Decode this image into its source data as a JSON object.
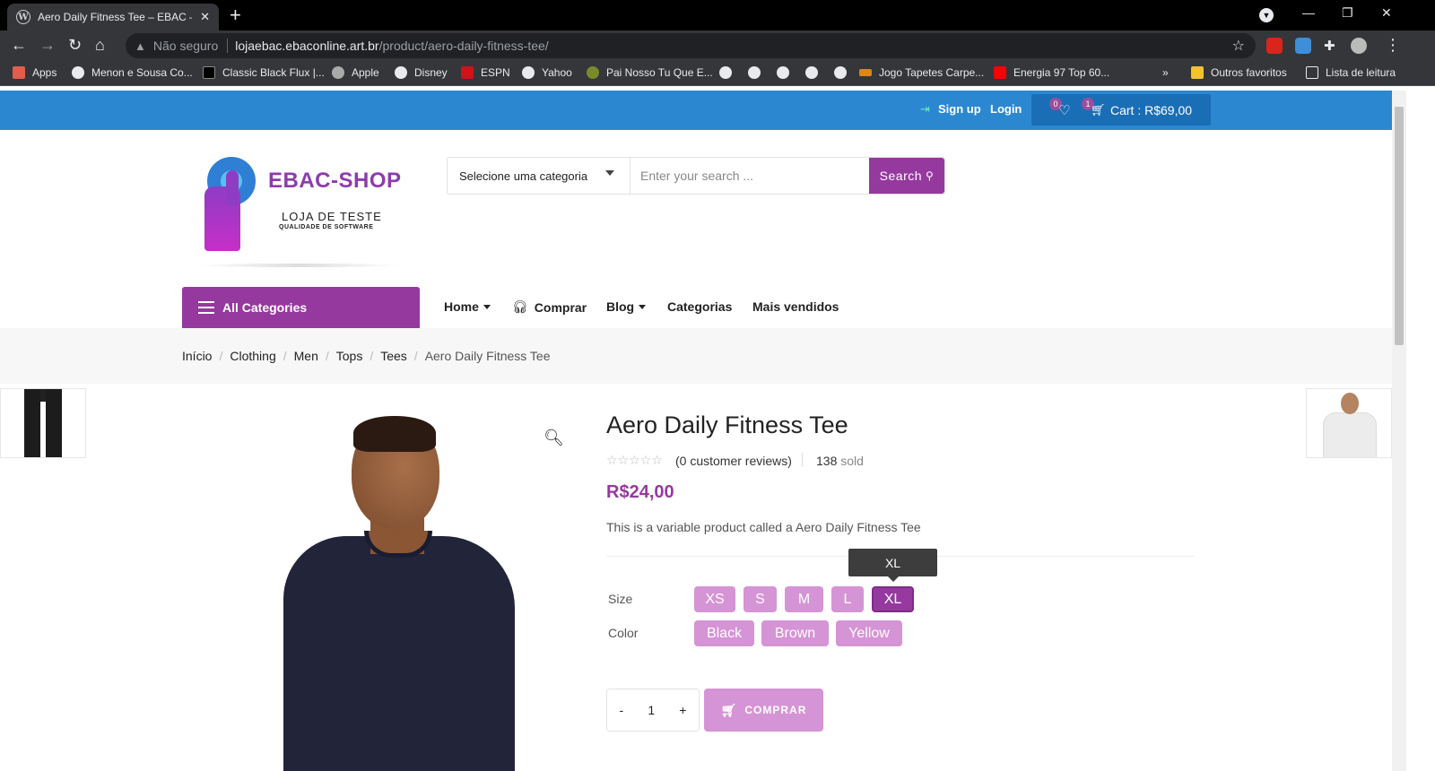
{
  "browser": {
    "tab_title": "Aero Daily Fitness Tee – EBAC – Shop",
    "not_secure": "Não seguro",
    "url_host": "lojaebac.ebaconline.art.br",
    "url_path": "/product/aero-daily-fitness-tee/",
    "bookmarks": [
      {
        "label": "Apps"
      },
      {
        "label": "Menon e Sousa Co..."
      },
      {
        "label": "Classic Black Flux |..."
      },
      {
        "label": "Apple"
      },
      {
        "label": "Disney"
      },
      {
        "label": "ESPN"
      },
      {
        "label": "Yahoo"
      },
      {
        "label": "Pai Nosso Tu Que E..."
      },
      {
        "label": "Jogo Tapetes Carpe..."
      },
      {
        "label": "Energia 97 Top 60..."
      },
      {
        "label": "»"
      },
      {
        "label": "Outros favoritos"
      },
      {
        "label": "Lista de leitura"
      }
    ]
  },
  "topbar": {
    "signup": "Sign up",
    "login": "Login",
    "wishlist_count": "0",
    "cart_count": "1",
    "cart_label": "Cart : R$69,00"
  },
  "logo": {
    "brand": "EBAC-SHOP",
    "line1": "LOJA DE TESTE",
    "line2": "QUALIDADE DE SOFTWARE"
  },
  "search": {
    "category": "Selecione uma categoria",
    "placeholder": "Enter your search ...",
    "button": "Search"
  },
  "menu": {
    "all_categories": "All Categories",
    "items": [
      "Home",
      "Comprar",
      "Blog",
      "Categorias",
      "Mais vendidos"
    ]
  },
  "breadcrumb": [
    "Início",
    "Clothing",
    "Men",
    "Tops",
    "Tees",
    "Aero Daily Fitness Tee"
  ],
  "product": {
    "title": "Aero Daily Fitness Tee",
    "stars": "☆☆☆☆☆",
    "reviews": "(0 customer reviews)",
    "sold_count": "138",
    "sold_label": "sold",
    "price": "R$24,00",
    "description": "This is a variable product called a Aero Daily Fitness Tee",
    "size_label": "Size",
    "sizes": [
      "XS",
      "S",
      "M",
      "L",
      "XL"
    ],
    "selected_size": "XL",
    "tooltip": "XL",
    "color_label": "Color",
    "colors": [
      "Black",
      "Brown",
      "Yellow"
    ],
    "qty_minus": "-",
    "qty_value": "1",
    "qty_plus": "+",
    "buy_label": "COMPRAR"
  },
  "colors": {
    "topbar": "#2b88d0",
    "accent": "#96399f",
    "swatch": "#d594d5"
  }
}
